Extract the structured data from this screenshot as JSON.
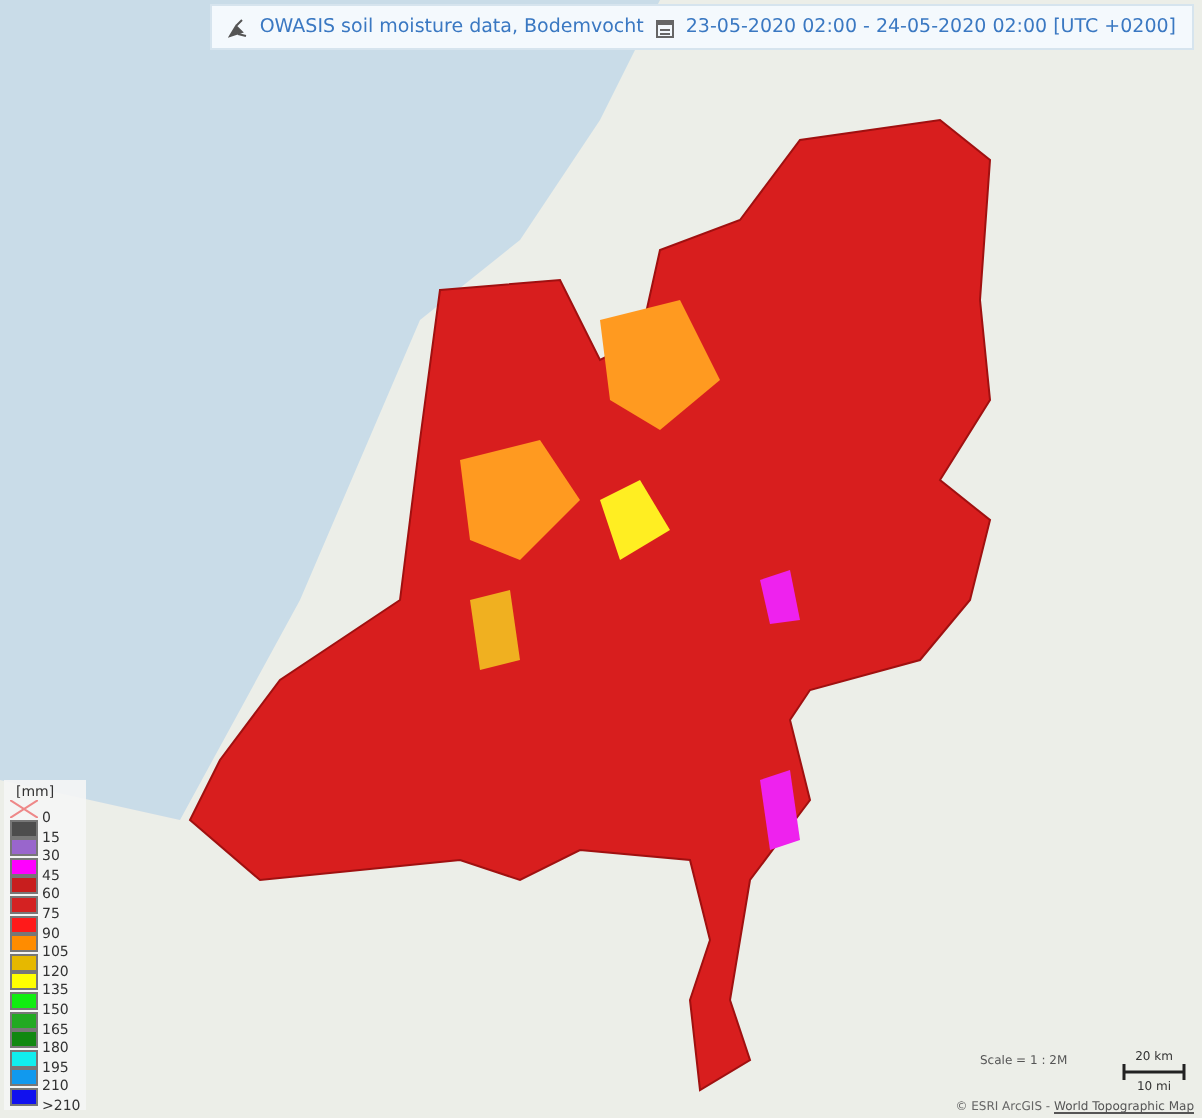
{
  "header": {
    "title": "OWASIS soil moisture data, Bodemvocht",
    "period": "23-05-2020 02:00 - 24-05-2020 02:00 [UTC +0200]"
  },
  "legend": {
    "unit": "[mm]",
    "entries": [
      {
        "kind": "nodata",
        "label": "0"
      },
      {
        "kind": "color",
        "color": "#4d4d4d",
        "label": "15"
      },
      {
        "kind": "color",
        "color": "#9966cc",
        "label": "30"
      },
      {
        "kind": "color",
        "color": "#ff00ff",
        "label": "45"
      },
      {
        "kind": "color",
        "color": "#c81e1e",
        "label": "60"
      },
      {
        "kind": "color",
        "color": "#d42222",
        "label": "75"
      },
      {
        "kind": "color",
        "color": "#ff1a1a",
        "label": "90"
      },
      {
        "kind": "color",
        "color": "#ff8c00",
        "label": "105"
      },
      {
        "kind": "color",
        "color": "#e6b800",
        "label": "120"
      },
      {
        "kind": "color",
        "color": "#ffff00",
        "label": "135"
      },
      {
        "kind": "color",
        "color": "#11ee11",
        "label": "150"
      },
      {
        "kind": "color",
        "color": "#22aa22",
        "label": "165"
      },
      {
        "kind": "color",
        "color": "#118811",
        "label": "180"
      },
      {
        "kind": "color",
        "color": "#11eeee",
        "label": "195"
      },
      {
        "kind": "color",
        "color": "#1199ee",
        "label": "210"
      },
      {
        "kind": "color",
        "color": "#1111ee",
        "label": ">210"
      }
    ]
  },
  "scale": {
    "ratio": "Scale = 1 : 2M",
    "km": "20 km",
    "mi": "10 mi"
  },
  "attribution": {
    "text": "© ESRI ArcGIS - ",
    "link": "World Topographic Map"
  }
}
